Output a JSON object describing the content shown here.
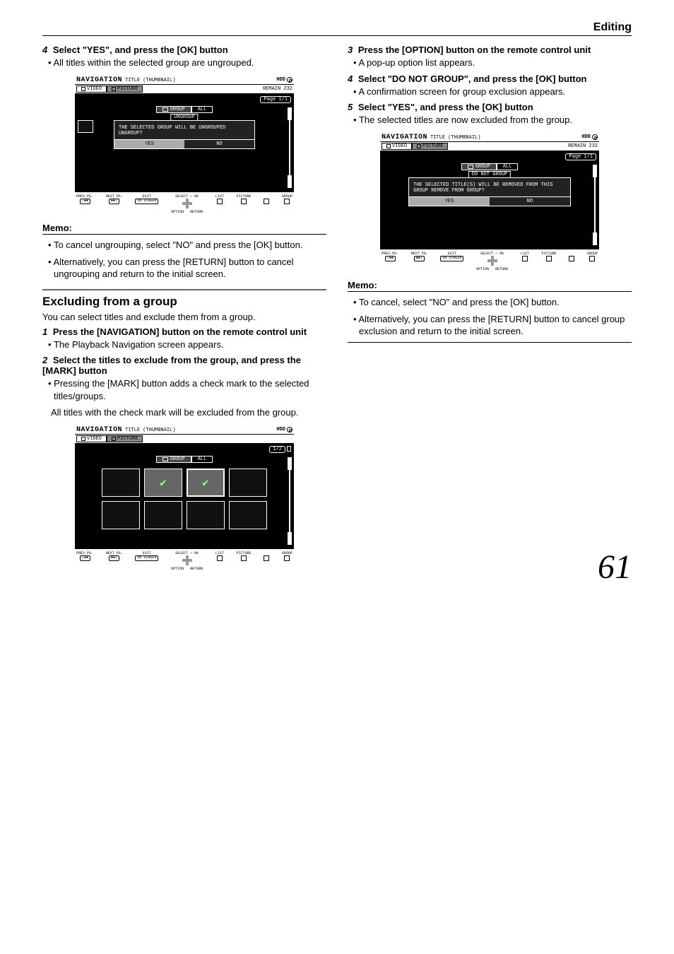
{
  "header": "Editing",
  "pageNumber": "61",
  "left": {
    "step4": {
      "num": "4",
      "text": "Select \"YES\", and press the [OK] button"
    },
    "step4_note": "All titles within the selected group are ungrouped.",
    "memo_label": "Memo:",
    "memo_items": [
      "To cancel ungrouping, select \"NO\" and press the [OK] button.",
      "Alternatively, you can press the [RETURN] button to cancel ungrouping and return to the initial screen."
    ],
    "section_title": "Excluding from a group",
    "section_intro": "You can select titles and exclude them from a group.",
    "step1": {
      "num": "1",
      "text": "Press the [NAVIGATION] button on the remote control unit"
    },
    "step1_note": "The Playback Navigation screen appears.",
    "step2": {
      "num": "2",
      "text": "Select the titles to exclude from the group, and press the [MARK] button"
    },
    "step2_note": "Pressing the [MARK] button adds a check mark to the selected titles/groups.",
    "step2_note2": "All titles with the check mark will be excluded from the group."
  },
  "right": {
    "step3": {
      "num": "3",
      "text": "Press the [OPTION] button on the remote control unit"
    },
    "step3_note": "A pop-up option list appears.",
    "step4": {
      "num": "4",
      "text": "Select \"DO NOT GROUP\", and press the [OK] button"
    },
    "step4_note": "A confirmation screen for group exclusion appears.",
    "step5": {
      "num": "5",
      "text": "Select \"YES\", and press the [OK] button"
    },
    "step5_note": "The selected titles are now excluded from the group.",
    "memo_label": "Memo:",
    "memo_items": [
      "To cancel, select \"NO\" and press the [OK] button.",
      "Alternatively, you can press the [RETURN] button to cancel group exclusion and return to the initial screen."
    ]
  },
  "device1": {
    "nav": "NAVIGATION",
    "subtitle": "TITLE (THUMBNAIL)",
    "hdd": "HDD",
    "tabs": [
      "VIDEO",
      "PICTURE"
    ],
    "remain": "REMAIN 232",
    "page": "Page    1/1",
    "filter": [
      "GROUP",
      "ALL"
    ],
    "dialog_title": "UNGROUP",
    "dialog_body": "THE SELECTED GROUP WILL BE UNGROUPED UNGROUP?",
    "yes": "YES",
    "no": "NO",
    "footer": {
      "prev": "PREV.PG.",
      "next": "NEXT PG.",
      "exit": "EXIT",
      "select": "SELECT",
      "ok": "OK",
      "option": "OPTION",
      "return": "RETURN",
      "list": "LIST",
      "picture": "PICTURE",
      "group": "GROUP",
      "key_prev": "|◄◄",
      "key_next": "►►|",
      "key_exit": "ON SCREEN"
    }
  },
  "device2": {
    "nav": "NAVIGATION",
    "subtitle": "TITLE (THUMBNAIL)",
    "hdd": "HDD",
    "tabs": [
      "VIDEO",
      "PICTURE"
    ],
    "remain": "",
    "page": "1/2",
    "filter": [
      "GROUP",
      "ALL"
    ],
    "footer": {
      "prev": "PREV.PG.",
      "next": "NEXT PG.",
      "exit": "EXIT",
      "select": "SELECT",
      "ok": "OK",
      "option": "OPTION",
      "return": "RETURN",
      "list": "LIST",
      "picture": "PICTURE",
      "group": "GROUP",
      "key_prev": "|◄◄",
      "key_next": "►►|",
      "key_exit": "ON SCREEN"
    }
  },
  "device3": {
    "nav": "NAVIGATION",
    "subtitle": "TITLE (THUMBNAIL)",
    "hdd": "HDD",
    "tabs": [
      "VIDEO",
      "PICTURE"
    ],
    "remain": "REMAIN 232",
    "page": "Page    1/1",
    "filter": [
      "GROUP",
      "ALL"
    ],
    "dialog_title": "DO NOT GROUP",
    "dialog_body": "THE SELECTED TITLE(S) WILL BE REMOVED FROM THIS GROUP REMOVE FROM GROUP?",
    "yes": "YES",
    "no": "NO",
    "footer": {
      "prev": "PREV.PG.",
      "next": "NEXT PG.",
      "exit": "EXIT",
      "select": "SELECT",
      "ok": "OK",
      "option": "OPTION",
      "return": "RETURN",
      "list": "LIST",
      "picture": "PICTURE",
      "group": "GROUP",
      "key_prev": "|◄◄",
      "key_next": "►►|",
      "key_exit": "ON SCREEN"
    }
  }
}
